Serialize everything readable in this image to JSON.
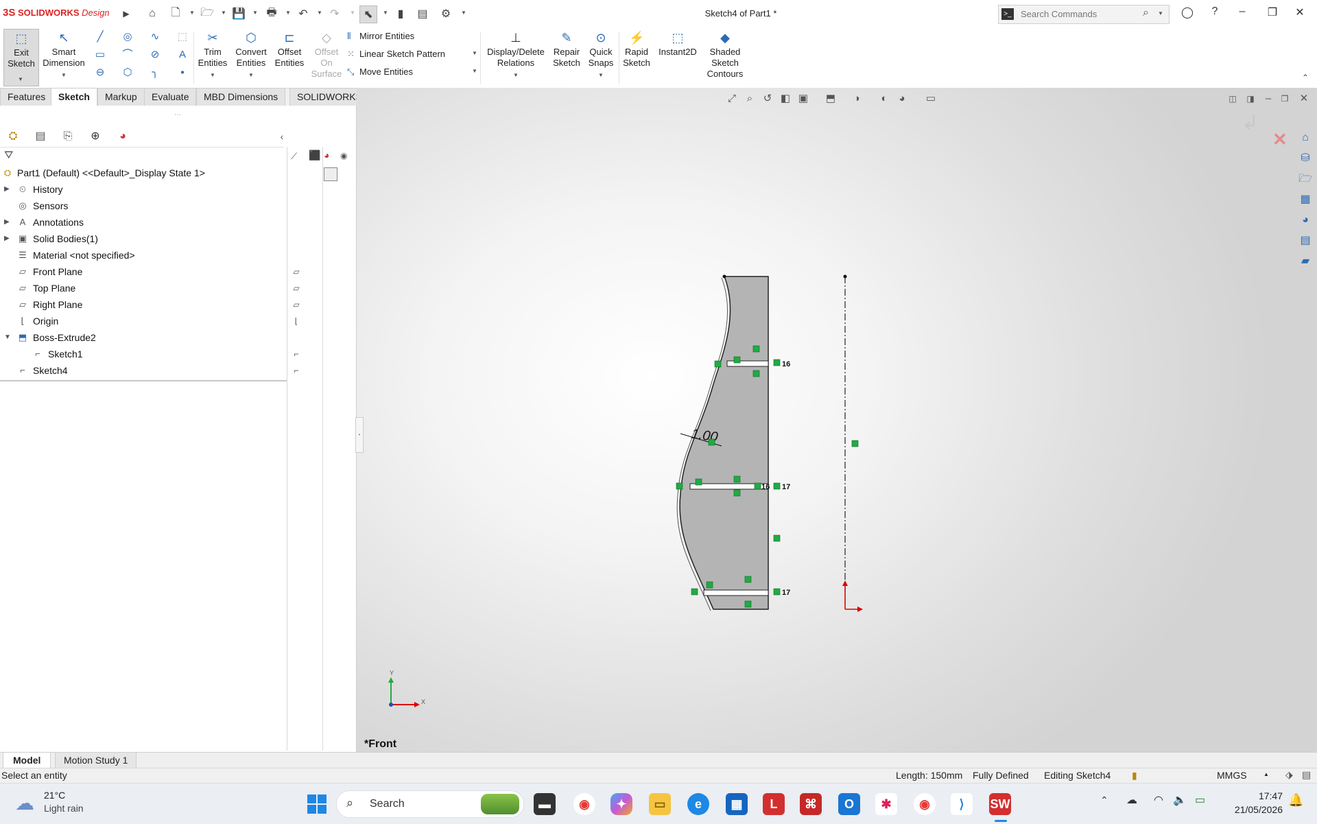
{
  "titlebar": {
    "brand_ds": "3S",
    "brand_name": "SOLIDWORKS",
    "brand_suffix": "Design",
    "doc_title": "Sketch4 of Part1 *",
    "search_placeholder": "Search Commands",
    "cmd_glyph": ">_"
  },
  "ribbon": {
    "exit_sketch": "Exit\nSketch",
    "exit_sketch_l1": "Exit",
    "exit_sketch_l2": "Sketch",
    "smart_dim_l1": "Smart",
    "smart_dim_l2": "Dimension",
    "trim_l1": "Trim",
    "trim_l2": "Entities",
    "convert_l1": "Convert",
    "convert_l2": "Entities",
    "offset_l1": "Offset",
    "offset_l2": "Entities",
    "offset_surf_l1": "Offset",
    "offset_surf_l2": "On",
    "offset_surf_l3": "Surface",
    "mirror": "Mirror Entities",
    "linear_pattern": "Linear Sketch Pattern",
    "move": "Move Entities",
    "display_rel_l1": "Display/Delete",
    "display_rel_l2": "Relations",
    "repair_l1": "Repair",
    "repair_l2": "Sketch",
    "quick_l1": "Quick",
    "quick_l2": "Snaps",
    "rapid_l1": "Rapid",
    "rapid_l2": "Sketch",
    "instant2d": "Instant2D",
    "shaded_l1": "Shaded",
    "shaded_l2": "Sketch",
    "shaded_l3": "Contours"
  },
  "command_tabs": [
    "Features",
    "Sketch",
    "Markup",
    "Evaluate",
    "MBD Dimensions",
    "SOLIDWORKS Add-Ins"
  ],
  "tree": {
    "root": "Part1 (Default) <<Default>_Display State 1>",
    "items": [
      "History",
      "Sensors",
      "Annotations",
      "Solid Bodies(1)",
      "Material <not specified>",
      "Front Plane",
      "Top Plane",
      "Right Plane",
      "Origin",
      "Boss-Extrude2",
      "Sketch1",
      "Sketch4"
    ]
  },
  "sketch": {
    "dimension": "1.00",
    "rel_16a": "16",
    "rel_17a": "17",
    "rel_16b": "16",
    "rel_17b": "17",
    "axis_x": "X",
    "axis_y": "Y"
  },
  "viewport": {
    "view_name": "*Front"
  },
  "bottom_tabs": [
    "Model",
    "Motion Study 1"
  ],
  "status": {
    "message": "Select an entity",
    "length": "Length: 150mm",
    "defined": "Fully Defined",
    "editing": "Editing Sketch4",
    "units": "MMGS"
  },
  "taskbar": {
    "temp": "21°C",
    "weather": "Light rain",
    "search": "Search",
    "time": "17:47",
    "date": "21/05/2026"
  },
  "colors": {
    "accent": "#2a6bb5",
    "brand": "#d22222",
    "sketch_fill": "#b4b4b4",
    "relation": "#22aa44"
  }
}
